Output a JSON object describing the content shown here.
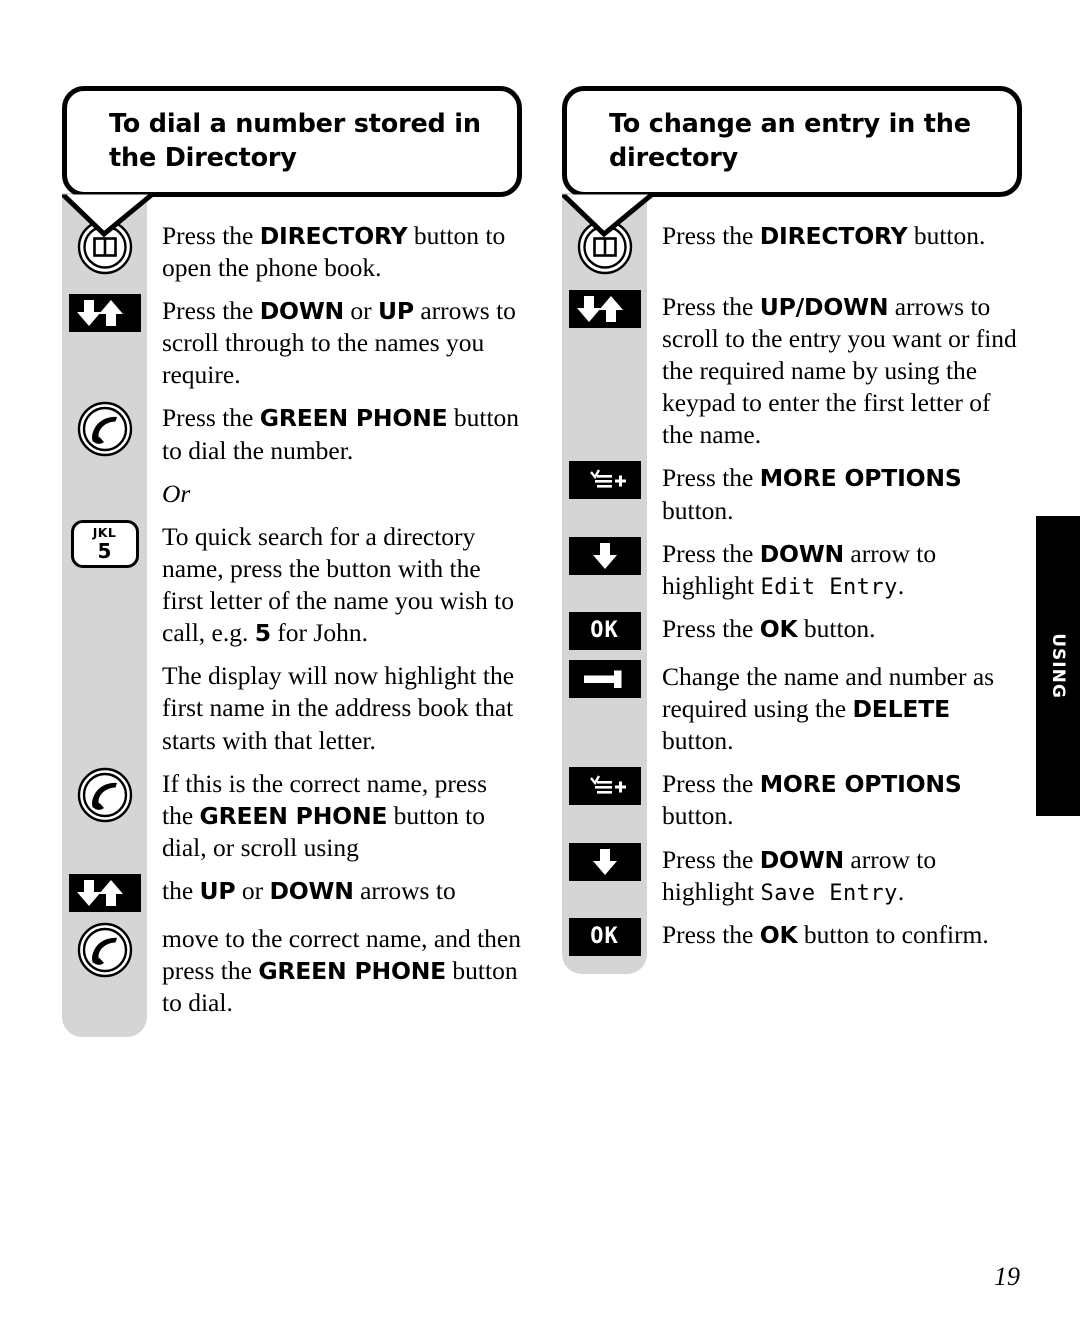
{
  "page": {
    "number": "19",
    "side_tab_label": "USING"
  },
  "columns": [
    {
      "id": "dial-stored-number",
      "heading": "To dial a number stored in the Directory",
      "steps": [
        {
          "icon": "directory-button-icon",
          "text_html": "Press the <b>DIRECTORY</b> button to open the phone book."
        },
        {
          "icon": "up-down-arrows-icon",
          "text_html": "Press the <b>DOWN</b> or <b>UP</b> arrows to scroll through to the names you require."
        },
        {
          "icon": "green-phone-icon",
          "text_html": "Press the <b>GREEN PHONE</b> button to dial the number."
        },
        {
          "icon": "none",
          "text_html": "<i>Or</i>"
        },
        {
          "icon": "keypad-5-jkl-icon",
          "text_html": "To quick search for a directory name, press the button with the first letter of the name you wish to call, e.g. <b>5</b> for John."
        },
        {
          "icon": "none",
          "text_html": "The display will now highlight the first name in the address book that starts with that letter."
        },
        {
          "icon": "green-phone-icon",
          "text_html": "If this is the correct name, press the <b>GREEN PHONE</b> button to dial, or scroll using"
        },
        {
          "icon": "up-down-arrows-icon",
          "text_html": "the <b>UP</b> or <b>DOWN</b> arrows to"
        },
        {
          "icon": "green-phone-icon",
          "text_html": "move to the correct name, and then press the <b>GREEN PHONE</b> button to dial."
        }
      ]
    },
    {
      "id": "change-directory-entry",
      "heading": "To change an entry in the directory",
      "steps": [
        {
          "icon": "directory-button-icon",
          "text_html": "Press the <b>DIRECTORY</b> button."
        },
        {
          "icon": "up-down-arrows-icon",
          "text_html": "Press the <b>UP/DOWN</b> arrows to scroll to the entry you want or find the required name by using the keypad to enter the first letter of the name."
        },
        {
          "icon": "more-options-icon",
          "text_html": "Press the <b>MORE OPTIONS</b> button."
        },
        {
          "icon": "down-arrow-icon",
          "text_html": "Press the <b>DOWN</b> arrow to highlight <span class=\"lcd\">Edit Entry</span>."
        },
        {
          "icon": "ok-button-icon",
          "text_html": "Press the <b>OK</b> button."
        },
        {
          "icon": "delete-button-icon",
          "text_html": "Change the name and number as required using the <b>DELETE</b> button."
        },
        {
          "icon": "more-options-icon",
          "text_html": "Press the <b>MORE OPTIONS</b> button."
        },
        {
          "icon": "down-arrow-icon",
          "text_html": "Press the <b>DOWN</b> arrow to highlight <span class=\"lcd\">Save Entry</span>."
        },
        {
          "icon": "ok-button-icon",
          "text_html": "Press the <b>OK</b> button to confirm."
        }
      ]
    }
  ],
  "icon_labels": {
    "ok": "OK",
    "keypad_5_letters": "JKL",
    "keypad_5_digit": "5"
  },
  "colors": {
    "panel_grey": "#d5d5d5",
    "ink": "#000000",
    "paper": "#ffffff"
  }
}
